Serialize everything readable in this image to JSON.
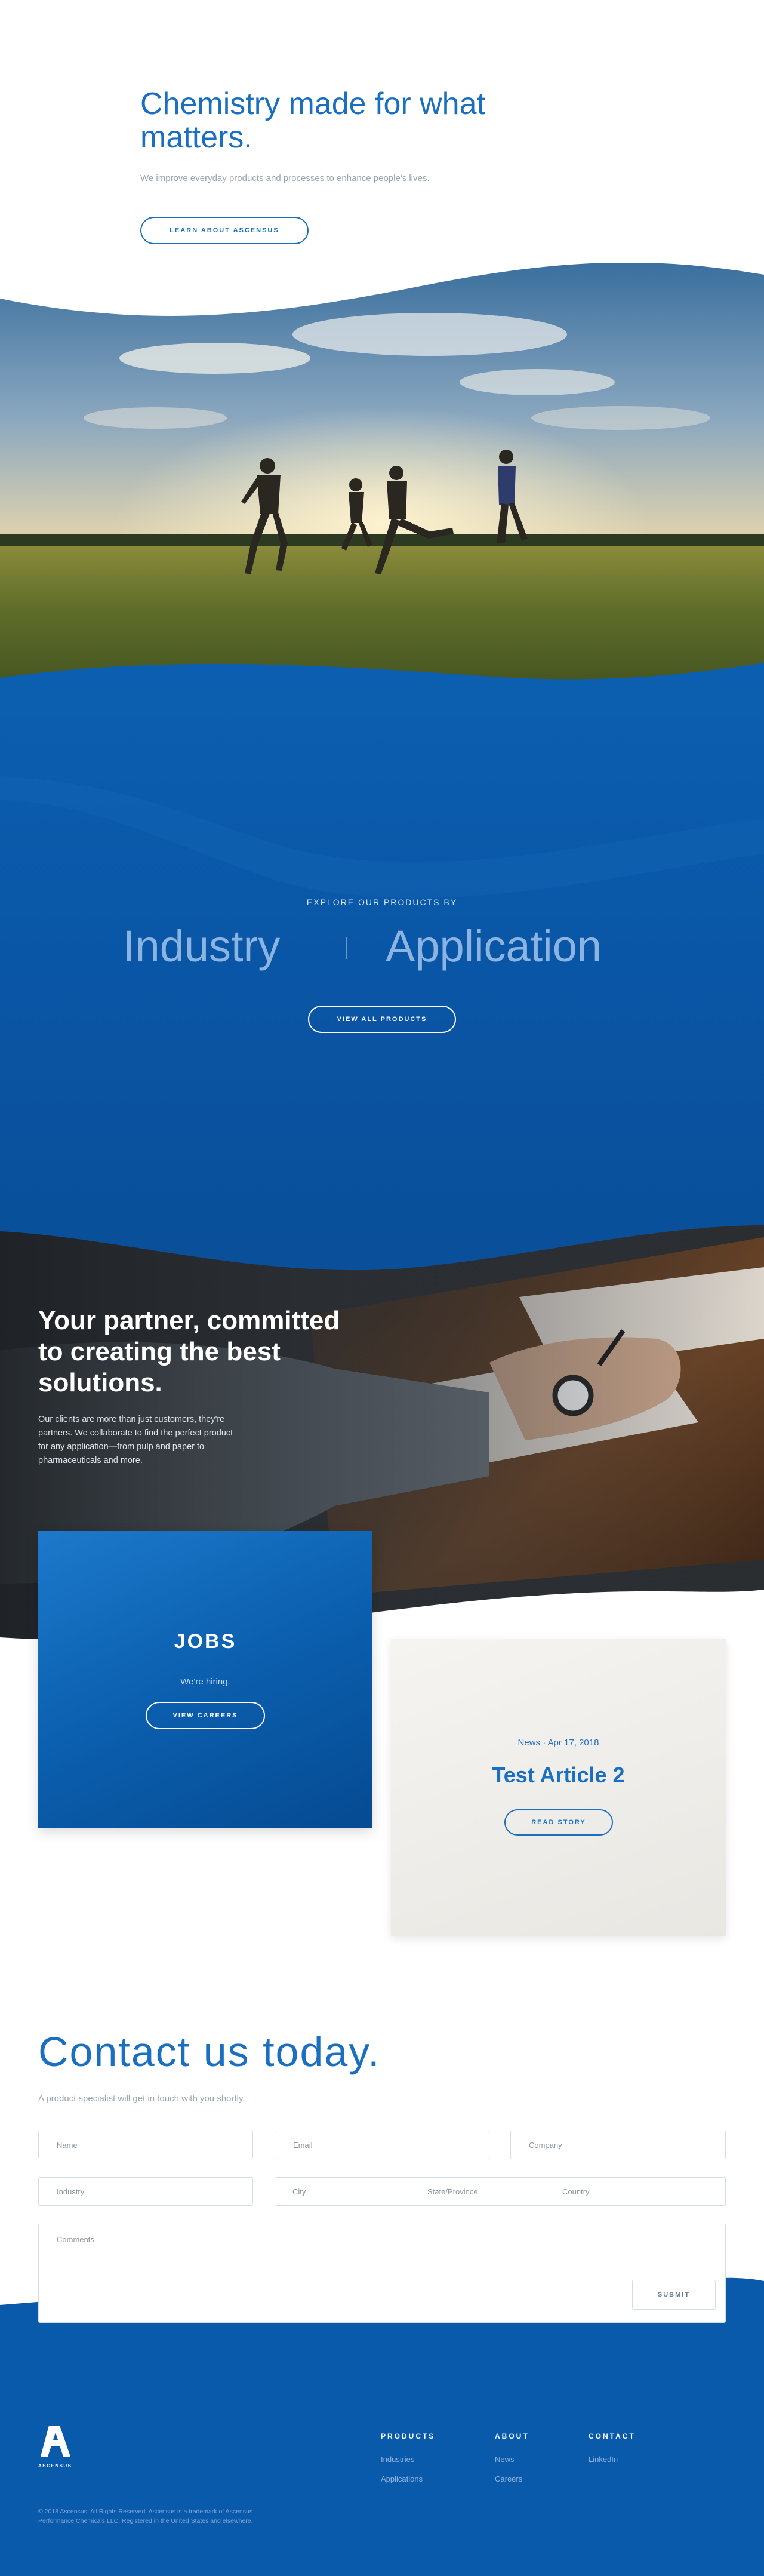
{
  "hero": {
    "title": "Chemistry made for what matters.",
    "subtitle": "We improve everyday products and processes to enhance people's lives.",
    "button": "LEARN ABOUT ASCENSUS"
  },
  "products": {
    "eyebrow": "EXPLORE OUR PRODUCTS BY",
    "categories": [
      "Industry",
      "Application"
    ],
    "button": "VIEW ALL PRODUCTS"
  },
  "partner": {
    "title": "Your partner, committed to creating the best solutions.",
    "body": "Our clients are more than just customers, they're partners. We collaborate to find the perfect product for any application—from pulp and paper to pharmaceuticals and more."
  },
  "jobs": {
    "title": "JOBS",
    "subtitle": "We're hiring.",
    "button": "VIEW CAREERS"
  },
  "news": {
    "meta": "News · Apr 17, 2018",
    "title": "Test Article 2",
    "button": "READ STORY"
  },
  "contact": {
    "title": "Contact us today.",
    "subtitle": "A product specialist will get in touch with you shortly.",
    "placeholders": {
      "name": "Name",
      "email": "Email",
      "company": "Company",
      "industry": "Industry",
      "city": "City",
      "state": "State/Province",
      "country": "Country",
      "comments": "Comments"
    },
    "submit": "SUBMIT"
  },
  "footer": {
    "logo_text": "ASCENSUS",
    "columns": [
      {
        "heading": "PRODUCTS",
        "links": [
          "Industries",
          "Applications"
        ]
      },
      {
        "heading": "ABOUT",
        "links": [
          "News",
          "Careers"
        ]
      },
      {
        "heading": "CONTACT",
        "links": [
          "LinkedIn"
        ]
      }
    ],
    "legal": "© 2018 Ascensus. All Rights Reserved. Ascensus is a trademark of Ascensus Performance Chemicals LLC, Registered in the United States and elsewhere."
  },
  "colors": {
    "brand_blue": "#1a6fc0",
    "deep_blue": "#0a56a6",
    "footer_blue": "#0a5aab"
  }
}
